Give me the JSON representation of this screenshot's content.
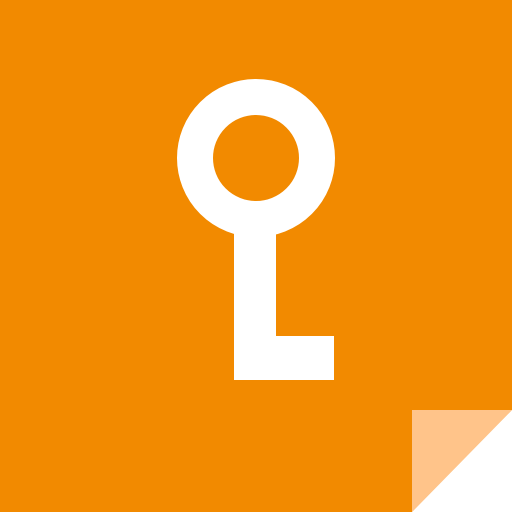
{
  "icon": {
    "name": "key-icon",
    "description_name": "key"
  },
  "colors": {
    "background": "#F28A00",
    "foreground": "#FFFFFF",
    "fold": "#FFC48A",
    "fold_corner": "#FFFFFF"
  }
}
